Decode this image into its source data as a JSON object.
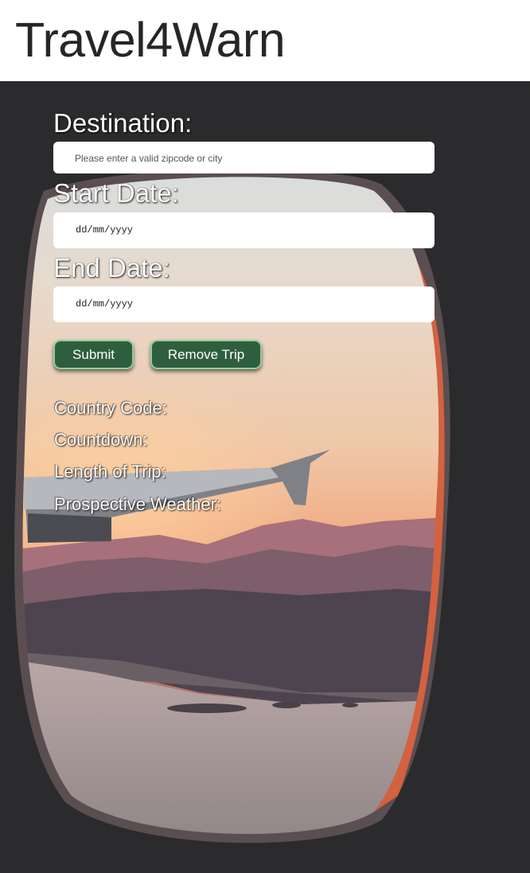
{
  "header": {
    "title": "Travel4Warn"
  },
  "form": {
    "destination": {
      "label": "Destination:",
      "placeholder": "Please enter a valid zipcode or city",
      "value": ""
    },
    "start_date": {
      "label": "Start Date:",
      "value": "dd/mm/yyyy"
    },
    "end_date": {
      "label": "End Date:",
      "value": "dd/mm/yyyy"
    },
    "submit_label": "Submit",
    "remove_label": "Remove Trip"
  },
  "results": {
    "country_code": "Country Code:",
    "countdown": "Countdown:",
    "length_of_trip": "Length of Trip:",
    "prospective_weather": "Prospective Weather:"
  },
  "colors": {
    "button_bg": "#2f5e3f",
    "button_border": "#8fcf9c",
    "background": "#2b2a2c"
  }
}
